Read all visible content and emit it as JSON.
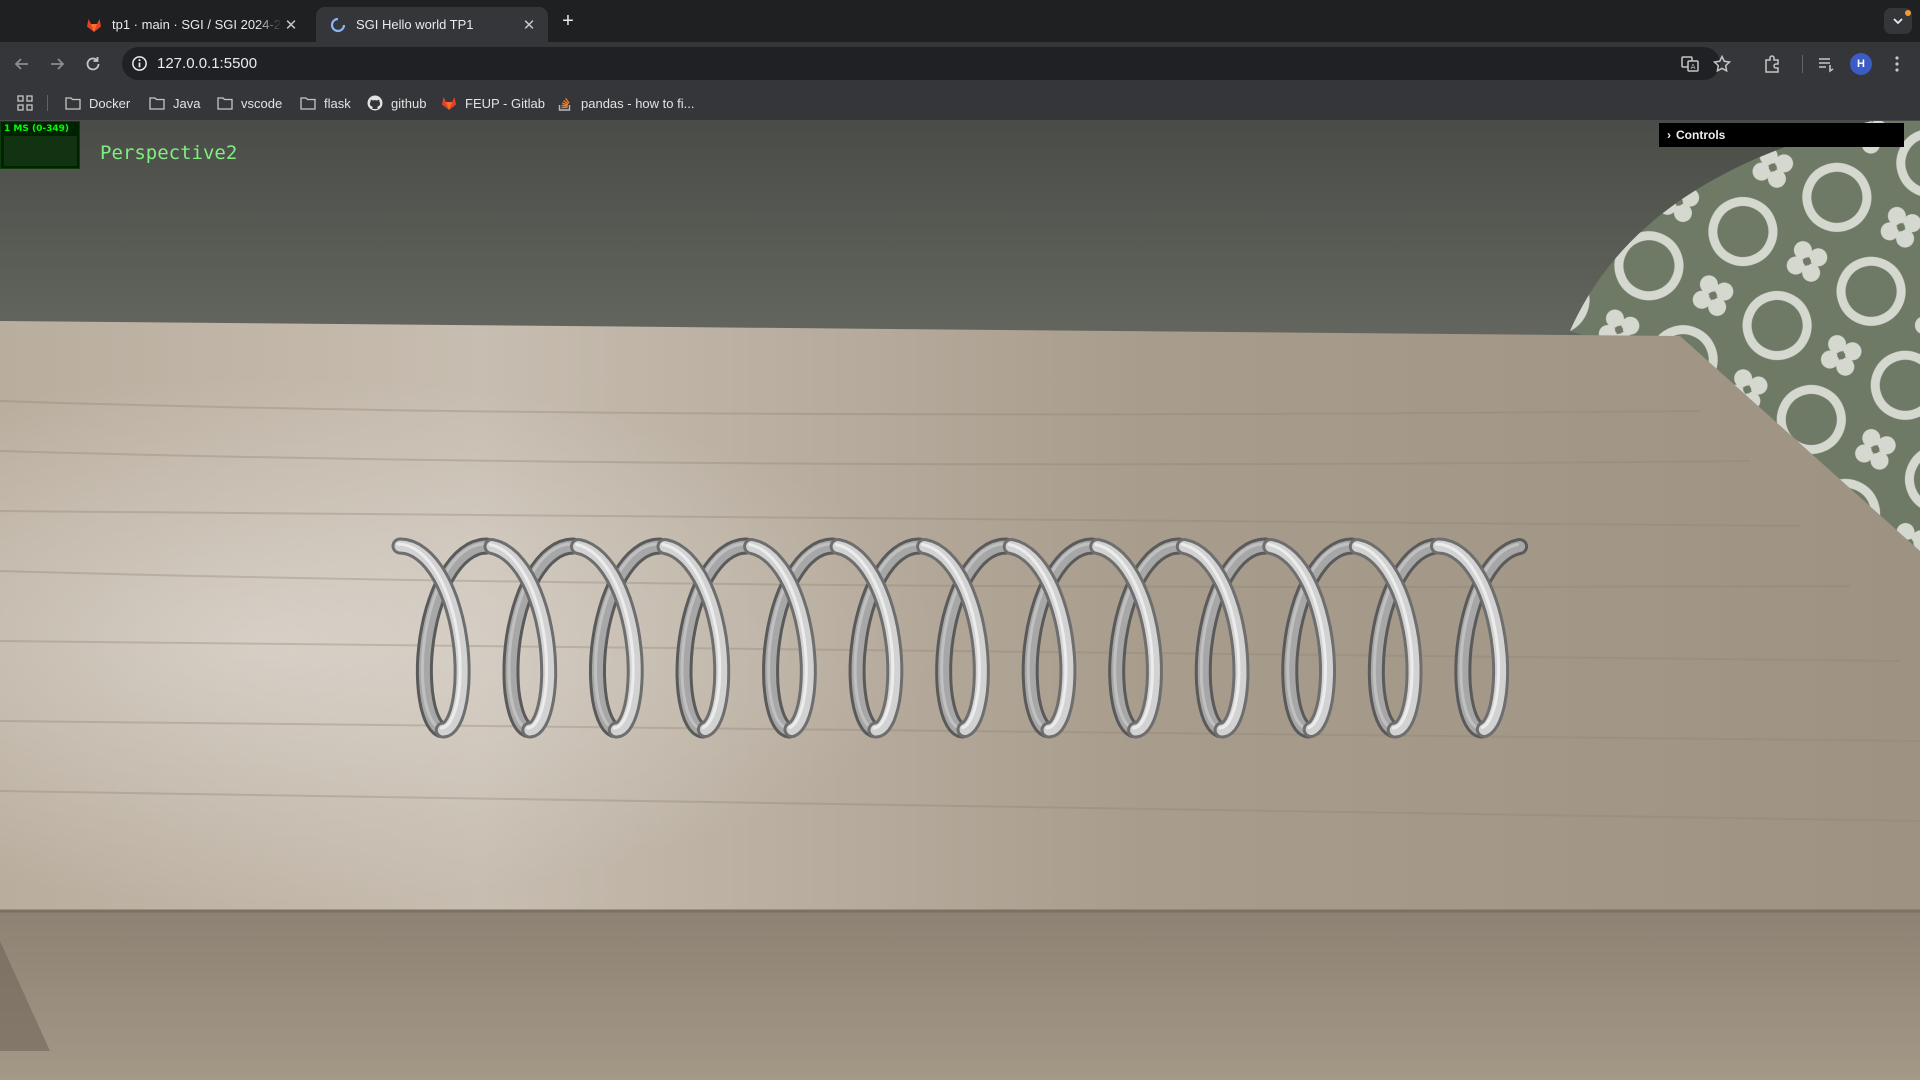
{
  "browser": {
    "tabs": [
      {
        "title": "tp1 · main · SGI / SGI 2024-20",
        "favicon": "gitlab-icon",
        "active": false
      },
      {
        "title": "SGI Hello world TP1",
        "favicon": "site-loading-icon",
        "active": true
      }
    ],
    "url": "127.0.0.1:5500",
    "profile_initial": "H",
    "bookmarks": [
      {
        "label": "Docker",
        "icon": "folder-icon"
      },
      {
        "label": "Java",
        "icon": "folder-icon"
      },
      {
        "label": "vscode",
        "icon": "folder-icon"
      },
      {
        "label": "flask",
        "icon": "folder-icon"
      },
      {
        "label": "github",
        "icon": "github-icon"
      },
      {
        "label": "FEUP - Gitlab",
        "icon": "gitlab-icon"
      },
      {
        "label": "pandas - how to fi...",
        "icon": "stackoverflow-icon"
      }
    ]
  },
  "scene": {
    "stats_label": "1 MS (0-349)",
    "camera_label": "Perspective2",
    "gui_title": "Controls",
    "colors": {
      "wall": "#5b5e56",
      "table": "#b7aa99",
      "spring": "#c9c9c9",
      "stats_text": "#00ff00",
      "camera_text": "#80ee80"
    }
  }
}
